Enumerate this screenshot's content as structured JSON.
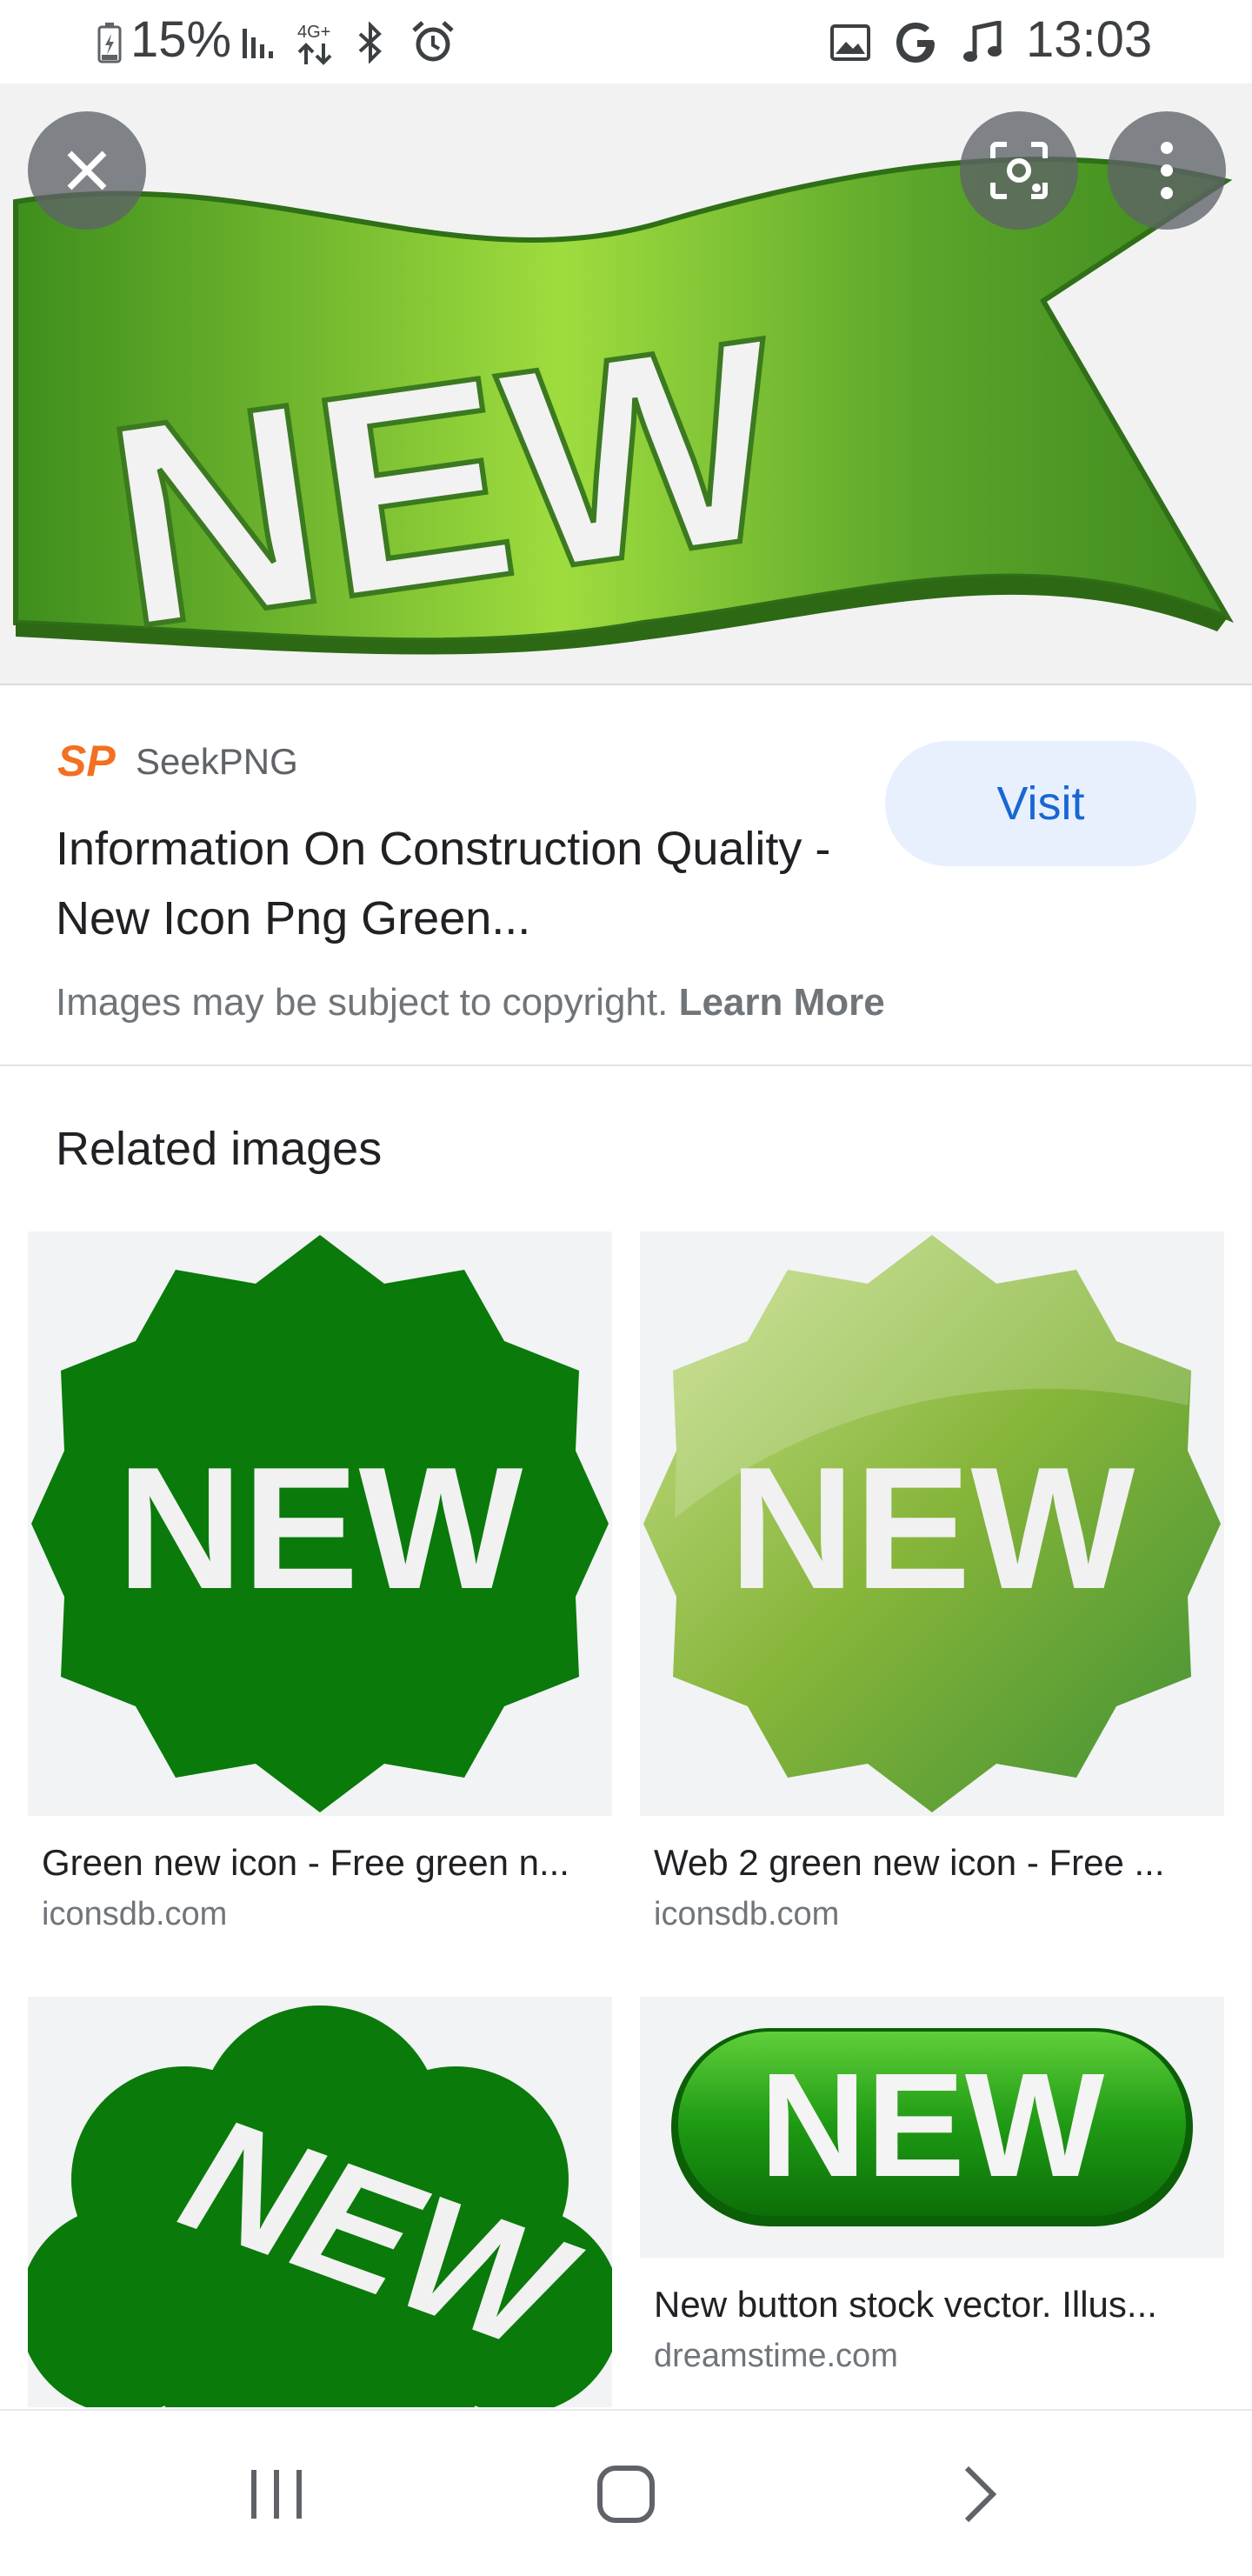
{
  "status_bar": {
    "battery": "15%",
    "network": "4G+",
    "time": "13:03",
    "icons": [
      "battery-icon",
      "signal-icon",
      "data-icon",
      "bluetooth-icon",
      "alarm-icon",
      "image-icon",
      "google-icon",
      "music-note-icon"
    ]
  },
  "hero": {
    "actions": [
      "close-icon",
      "lens-icon",
      "more-vert-icon"
    ]
  },
  "result": {
    "source_logo": "SP",
    "source_name": "SeekPNG",
    "visit_label": "Visit",
    "title": "Information On Construction Quality - New Icon Png Green...",
    "copyright_text": "Images may be subject to copyright.",
    "learn_more": "Learn More"
  },
  "related": {
    "heading": "Related images",
    "items": [
      {
        "title": "Green new icon - Free green n...",
        "source": "iconsdb.com",
        "image_text": "NEW"
      },
      {
        "title": "Web 2 green new icon - Free ...",
        "source": "iconsdb.com",
        "image_text": "NEW"
      },
      {
        "title": "",
        "source": "",
        "image_text": "NEW"
      },
      {
        "title": "New button stock vector. Illus...",
        "source": "dreamstime.com",
        "image_text": "NEW"
      }
    ]
  },
  "hero_image_text": "NEW",
  "colors": {
    "accent": "#1967d2",
    "visit_bg": "#e8f0fe",
    "dark_green": "#0a7a0a",
    "light_green": "#8bc34a",
    "logo_orange": "#f36f21"
  },
  "nav": {
    "buttons": [
      "recents-icon",
      "home-icon",
      "back-icon"
    ]
  }
}
